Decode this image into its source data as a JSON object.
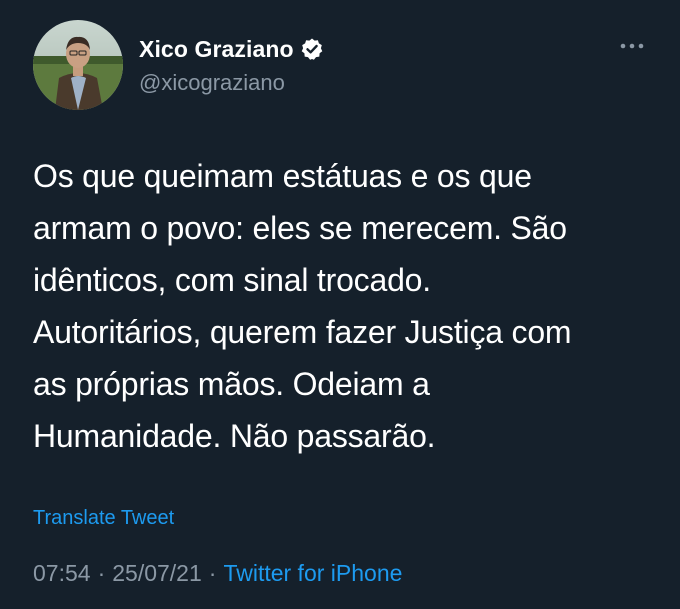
{
  "author": {
    "display_name": "Xico Graziano",
    "handle": "@xicograziano",
    "verified": true
  },
  "tweet": {
    "lines": [
      "Os que queimam estátuas e os que",
      "armam o povo: eles se merecem. São",
      "idênticos, com sinal trocado.",
      "Autoritários, querem fazer Justiça com",
      "as próprias mãos. Odeiam a",
      "Humanidade. Não passarão."
    ],
    "translate_label": "Translate Tweet",
    "time": "07:54",
    "date": "25/07/21",
    "separator": "·",
    "source": "Twitter for iPhone"
  },
  "colors": {
    "background": "#15202b",
    "text": "#ffffff",
    "secondary": "#8b98a5",
    "link": "#1d9bf0"
  },
  "icons": {
    "verified": "verified-badge-icon",
    "more": "more-options-icon"
  }
}
